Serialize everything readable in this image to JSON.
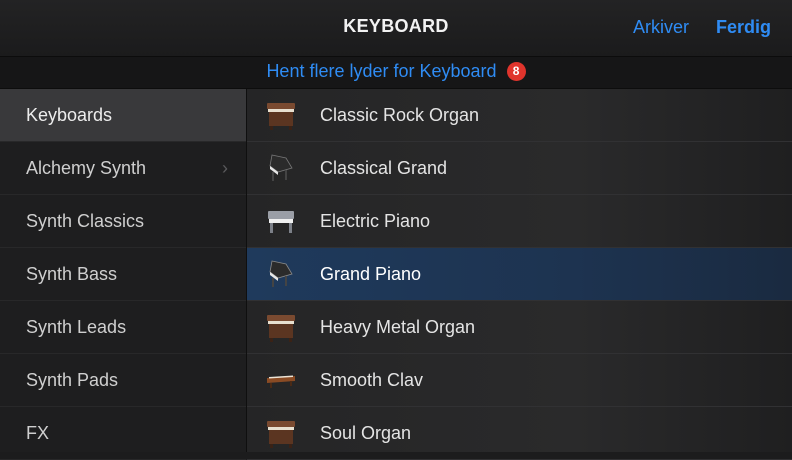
{
  "header": {
    "title": "KEYBOARD",
    "archive_label": "Arkiver",
    "done_label": "Ferdig"
  },
  "banner": {
    "text": "Hent flere lyder for Keyboard",
    "badge_count": "8"
  },
  "sidebar": {
    "items": [
      {
        "label": "Keyboards",
        "selected": true
      },
      {
        "label": "Alchemy Synth",
        "has_submenu": true
      },
      {
        "label": "Synth Classics"
      },
      {
        "label": "Synth Bass"
      },
      {
        "label": "Synth Leads"
      },
      {
        "label": "Synth Pads"
      },
      {
        "label": "FX"
      }
    ]
  },
  "instruments": [
    {
      "label": "Classic Rock Organ",
      "icon": "organ-icon"
    },
    {
      "label": "Classical Grand",
      "icon": "grand-piano-icon"
    },
    {
      "label": "Electric Piano",
      "icon": "electric-piano-icon"
    },
    {
      "label": "Grand Piano",
      "icon": "grand-piano-icon",
      "selected": true
    },
    {
      "label": "Heavy Metal Organ",
      "icon": "organ-icon"
    },
    {
      "label": "Smooth Clav",
      "icon": "clav-icon"
    },
    {
      "label": "Soul Organ",
      "icon": "organ-icon"
    }
  ],
  "colors": {
    "accent": "#2f8cf4",
    "badge": "#e0342c",
    "selected_row": "#1f3a5c"
  }
}
